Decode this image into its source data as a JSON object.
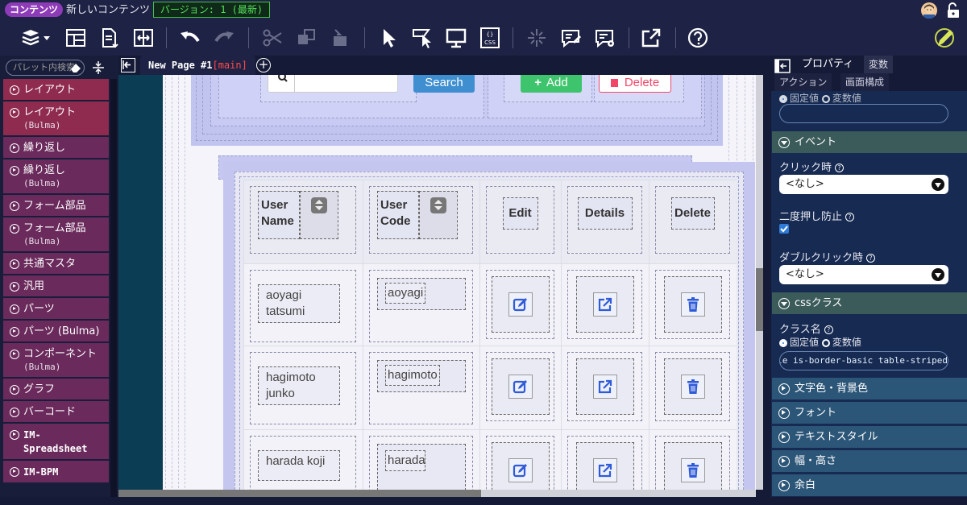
{
  "titlebar": {
    "chip": "コンテンツ",
    "content_name": "新しいコンテンツ",
    "version": "バージョン: 1 (最新)"
  },
  "palette": {
    "search_placeholder": "パレット内検索",
    "items": [
      {
        "label": "レイアウト",
        "sub": "",
        "color": "#8f2b4e"
      },
      {
        "label": "レイアウト",
        "sub": "(Bulma)",
        "color": "#8f2b4e"
      },
      {
        "label": "繰り返し",
        "sub": "",
        "color": "#6a2a5c"
      },
      {
        "label": "繰り返し",
        "sub": "(Bulma)",
        "color": "#6a2a5c"
      },
      {
        "label": "フォーム部品",
        "sub": "",
        "color": "#6a2a5c"
      },
      {
        "label": "フォーム部品",
        "sub": "(Bulma)",
        "color": "#6a2a5c"
      },
      {
        "label": "共通マスタ",
        "sub": "",
        "color": "#6a2a5c"
      },
      {
        "label": "汎用",
        "sub": "",
        "color": "#6a2a5c"
      },
      {
        "label": "パーツ",
        "sub": "",
        "color": "#6a2a5c"
      },
      {
        "label": "パーツ (Bulma)",
        "sub": "",
        "color": "#6a2a5c"
      },
      {
        "label": "コンポーネント",
        "sub": "(Bulma)",
        "color": "#6a2a5c"
      },
      {
        "label": "グラフ",
        "sub": "",
        "color": "#6a2a5c"
      },
      {
        "label": "バーコード",
        "sub": "",
        "color": "#6a2a5c"
      },
      {
        "label": "IM-Spreadsheet",
        "sub": "",
        "color": "#6a2a5c",
        "mono": true
      },
      {
        "label": "IM-BPM",
        "sub": "",
        "color": "#6a2a5c",
        "mono": true
      }
    ]
  },
  "tabs": {
    "page_title": "New Page #1",
    "page_tag": "[main]"
  },
  "canvas": {
    "search_button": "Search",
    "add_button": "Add",
    "delete_button": "Delete",
    "headers": [
      "User Name",
      "User Code",
      "Edit",
      "Details",
      "Delete"
    ],
    "rows": [
      {
        "name": "aoyagi tatsumi",
        "code": "aoyagi"
      },
      {
        "name": "hagimoto junko",
        "code": "hagimoto"
      },
      {
        "name": "harada koji",
        "code": "harada"
      }
    ]
  },
  "props": {
    "tabs": [
      "プロパティ",
      "変数",
      "アクション",
      "画面構成"
    ],
    "top_radio_fixed": "固定値",
    "top_radio_var": "変数値",
    "event_section": "イベント",
    "click_label": "クリック時",
    "click_value": "<なし>",
    "double_prevent_label": "二度押し防止",
    "dblclick_label": "ダブルクリック時",
    "dblclick_value": "<なし>",
    "css_section": "cssクラス",
    "class_label": "クラス名",
    "radio_fixed": "固定値",
    "radio_var": "変数値",
    "class_value": "table is-border-basic table-striped",
    "collapsed_sections": [
      "文字色・背景色",
      "フォント",
      "テキストスタイル",
      "幅・高さ",
      "余白"
    ]
  },
  "colors": {
    "accent_green": "#3ec46d",
    "accent_blue": "#3e8ed0",
    "accent_red": "#f14668",
    "icon_blue": "#2f5bd8"
  }
}
